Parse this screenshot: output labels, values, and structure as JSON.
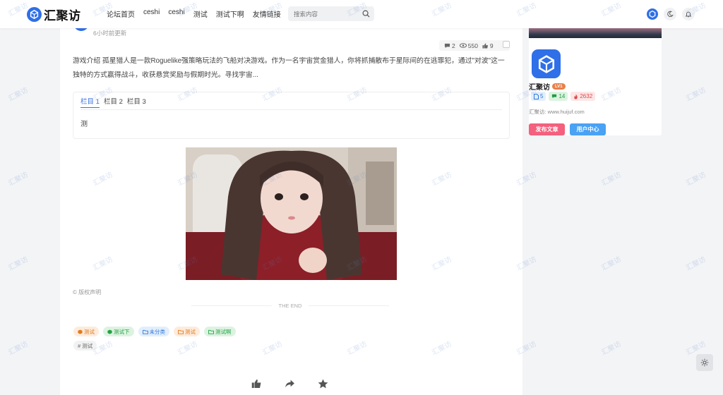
{
  "header": {
    "logo_text": "汇聚访",
    "nav": [
      "论坛首页",
      "ceshi",
      "ceshi",
      "测试",
      "测试下啊",
      "友情链接"
    ],
    "search_placeholder": "搜索内容"
  },
  "post": {
    "time": "6小时前更新",
    "stats": {
      "comments": "2",
      "views": "550",
      "likes": "9"
    },
    "intro": "游戏介绍 孤星猎人是一款Roguelike强策略玩法的飞船对决游戏。作为一名宇宙赏金猎人，你将抓捕散布于星际间的在逃罪犯，通过\"对波\"这一独特的方式赢得战斗，收获悬赏奖励与假期时光。寻找宇宙...",
    "tabs": [
      "栏目 1",
      "栏目 2",
      "栏目 3"
    ],
    "tab_content": "测",
    "copyright": "© 版权声明",
    "the_end": "THE END",
    "tags": [
      {
        "label": "测试",
        "color": "orange",
        "icon": "cube-icon"
      },
      {
        "label": "测试下",
        "color": "green",
        "icon": "cube-icon"
      },
      {
        "label": "未分类",
        "color": "blue",
        "icon": "folder-icon"
      },
      {
        "label": "测试",
        "color": "orange",
        "icon": "folder-icon"
      },
      {
        "label": "测试啊",
        "color": "green",
        "icon": "folder-icon"
      }
    ],
    "hashtag": "# 测试"
  },
  "sidebar": {
    "name": "汇聚访",
    "level": "LV1",
    "posts": "5",
    "comments": "14",
    "popularity": "2632",
    "site": "汇聚访: www.huijuf.com",
    "publish_button": "发布文章",
    "user_center_button": "用户中心"
  },
  "watermark": "汇聚访",
  "colors": {
    "brand": "#2f6fe8",
    "accent_tab": "#3a6fe0",
    "pink": "#f4607d",
    "blue_btn": "#49a2f4"
  }
}
